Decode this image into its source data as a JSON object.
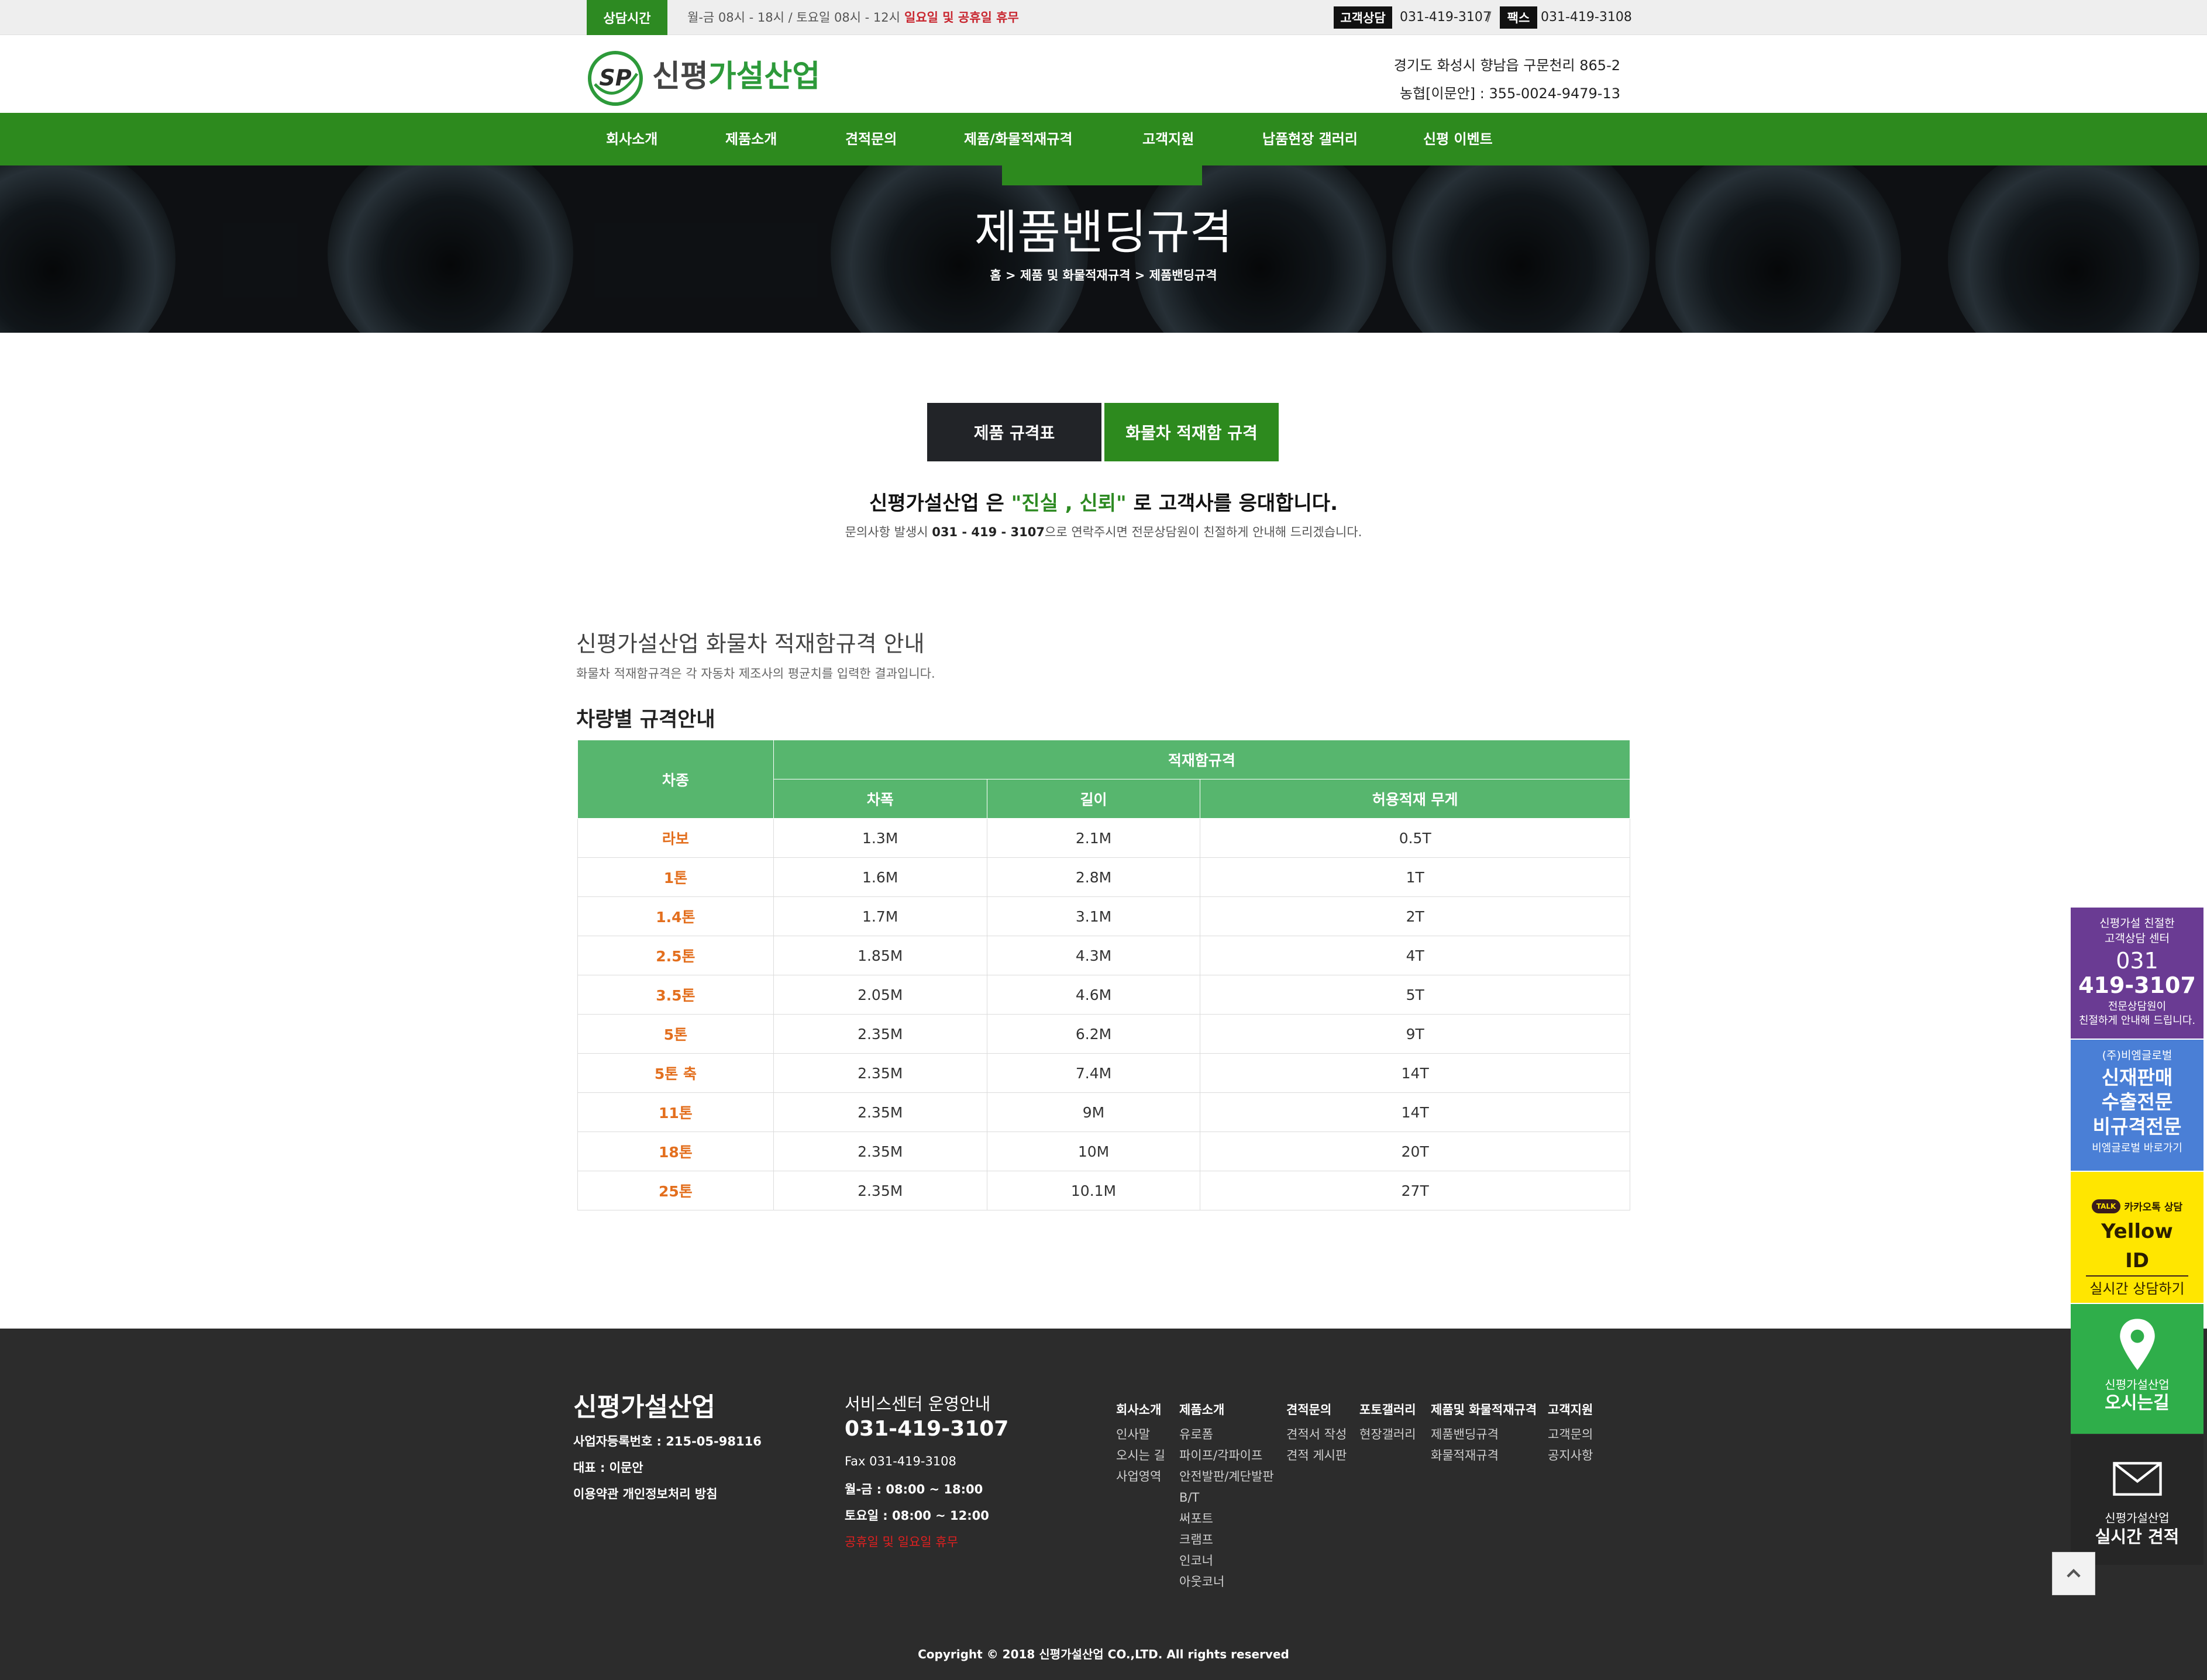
{
  "topbar": {
    "consult_tag": "상담시간",
    "hours": "월-금 08시 - 18시 / 토요일 08시 - 12시",
    "holiday": "일요일 및 공휴일 휴무",
    "cs_label": "고객상담",
    "cs_phone": "031-419-3107",
    "slash": "/",
    "fax_label": "팩스",
    "fax_phone": "031-419-3108"
  },
  "header": {
    "logo_mark": "SP",
    "logo_part1": "신평",
    "logo_part2": "가설산업",
    "address": "경기도 화성시 향남읍 구문천리 865-2",
    "bank": "농협[이문안] : 355-0024-9479-13"
  },
  "nav": {
    "items": [
      {
        "label": "회사소개"
      },
      {
        "label": "제품소개"
      },
      {
        "label": "견적문의"
      },
      {
        "label": "제품/화물적재규격"
      },
      {
        "label": "고객지원"
      },
      {
        "label": "납품현장 갤러리"
      },
      {
        "label": "신평 이벤트"
      }
    ]
  },
  "hero": {
    "title": "제품밴딩규격",
    "breadcrumb": "홈 > 제품 및 화물적재규격 > 제품밴딩규격"
  },
  "tabs": {
    "spec": "제품 규격표",
    "truck": "화물차 적재함 규격"
  },
  "slogan": {
    "pre": "신평가설산업 은 ",
    "quote": "\"진실 , 신뢰\"",
    "post": " 로 고객사를 응대합니다.",
    "note_pre": "문의사항 발생시 ",
    "note_phone": "031 - 419 - 3107",
    "note_post": "으로 연락주시면 전문상담원이 친절하게 안내해 드리겠습니다."
  },
  "section": {
    "title": "신평가설산업 화물차 적재함규격 안내",
    "desc": "화물차 적재함규격은 각 자동차 제조사의 평균치를 입력한 결과입니다.",
    "table_title": "차량별 규격안내"
  },
  "table": {
    "col_car": "차종",
    "col_group": "적재함규격",
    "col_width": "차폭",
    "col_length": "길이",
    "col_weight": "허용적재 무게",
    "rows": [
      {
        "car": "라보",
        "width": "1.3M",
        "length": "2.1M",
        "weight": "0.5T"
      },
      {
        "car": "1톤",
        "width": "1.6M",
        "length": "2.8M",
        "weight": "1T"
      },
      {
        "car": "1.4톤",
        "width": "1.7M",
        "length": "3.1M",
        "weight": "2T"
      },
      {
        "car": "2.5톤",
        "width": "1.85M",
        "length": "4.3M",
        "weight": "4T"
      },
      {
        "car": "3.5톤",
        "width": "2.05M",
        "length": "4.6M",
        "weight": "5T"
      },
      {
        "car": "5톤",
        "width": "2.35M",
        "length": "6.2M",
        "weight": "9T"
      },
      {
        "car": "5톤 축",
        "width": "2.35M",
        "length": "7.4M",
        "weight": "14T"
      },
      {
        "car": "11톤",
        "width": "2.35M",
        "length": "9M",
        "weight": "14T"
      },
      {
        "car": "18톤",
        "width": "2.35M",
        "length": "10M",
        "weight": "20T"
      },
      {
        "car": "25톤",
        "width": "2.35M",
        "length": "10.1M",
        "weight": "27T"
      }
    ]
  },
  "footer": {
    "brand": "신평가설산업",
    "biz_no": "사업자등록번호 : 215-05-98116",
    "ceo": "대표 : 이문안",
    "terms": "이용약관",
    "privacy": "개인정보처리 방침",
    "svc_title": "서비스센터 운영안내",
    "svc_phone": "031-419-3107",
    "svc_fax": "Fax 031-419-3108",
    "svc_weekday": "월-금 : 08:00 ~ 18:00",
    "svc_saturday": "토요일 : 08:00 ~ 12:00",
    "svc_holiday": "공휴일 및 일요일 휴무",
    "cols": [
      {
        "title": "회사소개",
        "items": [
          "인사말",
          "오시는 길",
          "사업영역"
        ]
      },
      {
        "title": "제품소개",
        "items": [
          "유로폼",
          "파이프/각파이프",
          "안전발판/계단발판",
          "B/T",
          "써포트",
          "크램프",
          "인코너",
          "아웃코너"
        ]
      },
      {
        "title": "견적문의",
        "items": [
          "견적서 작성",
          "견적 게시판"
        ]
      },
      {
        "title": "포토갤러리",
        "items": [
          "현장갤러리"
        ]
      },
      {
        "title": "제품및 화물적재규격",
        "items": [
          "제품밴딩규격",
          "화물적재규격"
        ]
      },
      {
        "title": "고객지원",
        "items": [
          "고객문의",
          "공지사항"
        ]
      }
    ],
    "copyright": "Copyright © 2018 신평가설산업 CO.,LTD. All rights reserved"
  },
  "side": {
    "purple_line1": "신평가설 친절한",
    "purple_line2": "고객상담 센터",
    "purple_phone1": "031",
    "purple_phone2": "419-3107",
    "purple_line3": "전문상담원이",
    "purple_line4": "친절하게 안내해 드립니다.",
    "blue_line1": "(주)비엠글로벌",
    "blue_line2": "신재판매",
    "blue_line3": "수출전문",
    "blue_line4": "비규격전문",
    "blue_line5": "비엠글로벌 바로가기",
    "yellow_badge": "TALK",
    "yellow_line1": "카카오톡 상담",
    "yellow_line2": "Yellow ID",
    "yellow_line3": "실시간 상담하기",
    "green_line1": "신평가설산업",
    "green_line2": "오시는길",
    "dark_line1": "신평가설산업",
    "dark_line2": "실시간 견적"
  },
  "colors": {
    "brand_green": "#2d8a1e",
    "table_header": "#57b66e",
    "car_orange": "#e36f1e",
    "holiday_red": "#c8262f",
    "footer_bg": "#2c2c2c"
  }
}
